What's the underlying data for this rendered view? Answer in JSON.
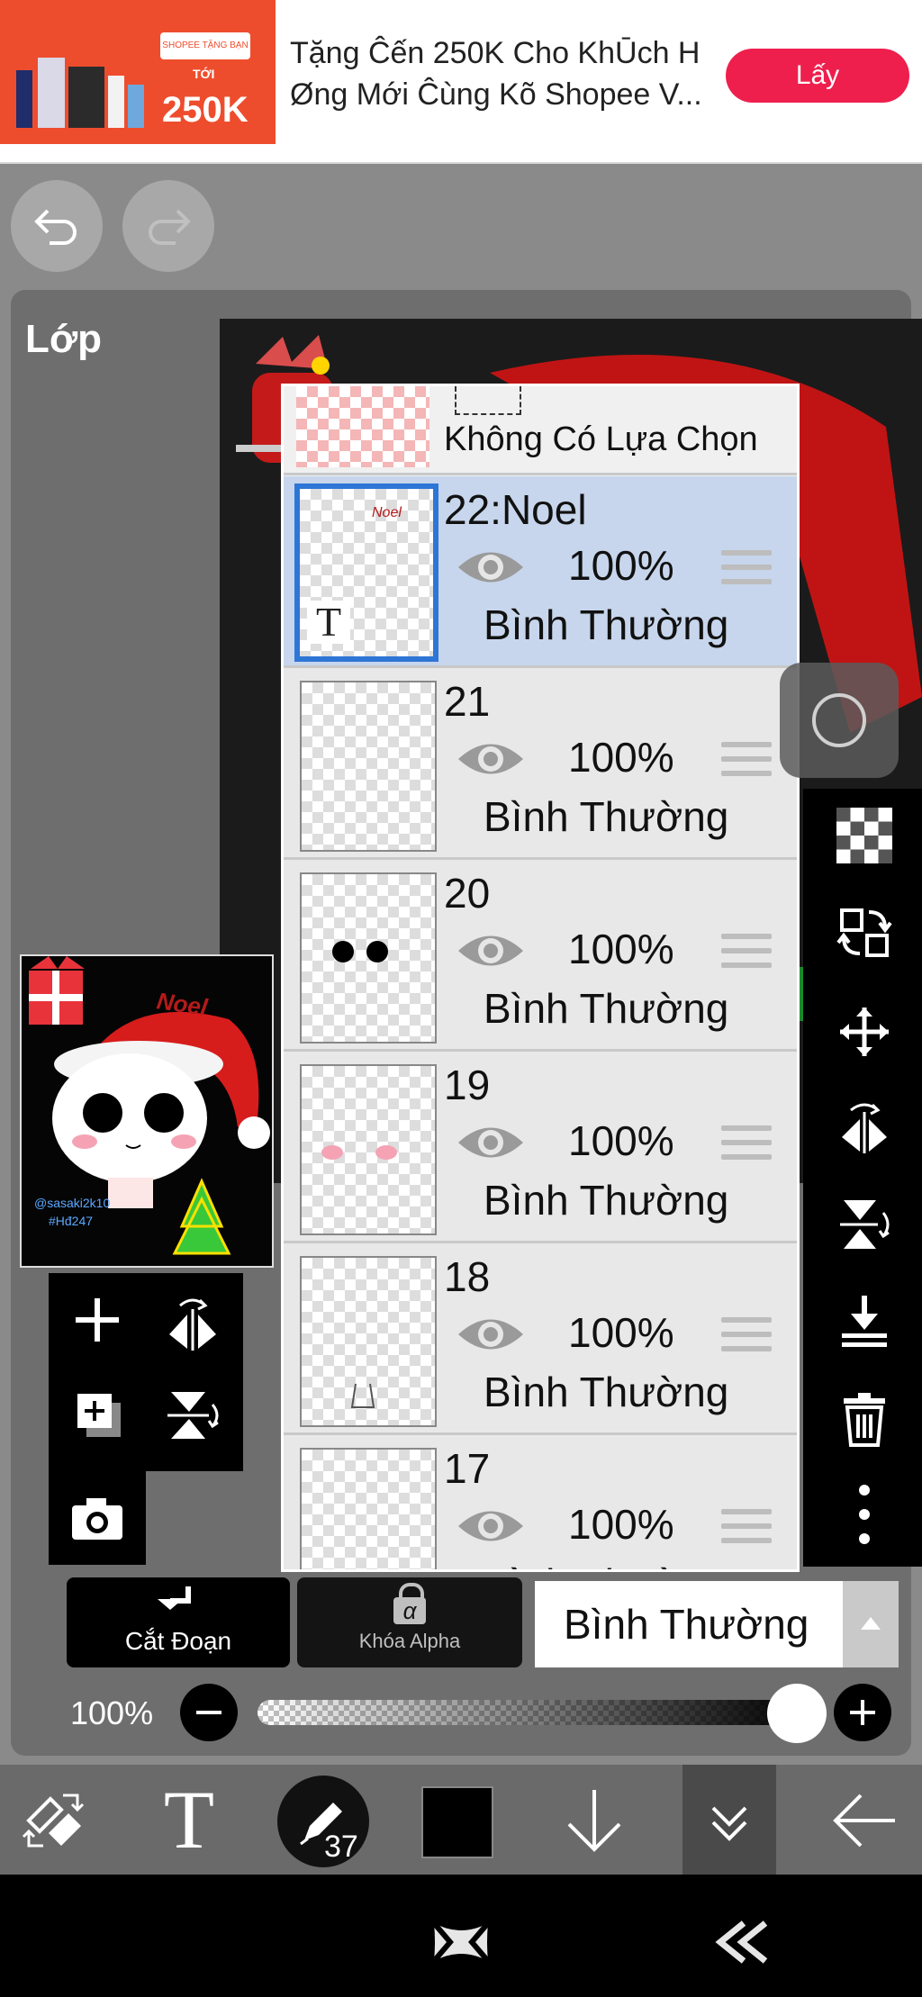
{
  "ad": {
    "image_amount": "250K",
    "image_prefix": "TỚI",
    "image_brand": "SHOPEE TẶNG BẠN MỚI",
    "text": "Tặng Ĉến 250K Cho KhŪch H Øng Mới Ĉùng Kõ Shopee V...",
    "button_label": "Lấy"
  },
  "panel": {
    "title": "Lớp"
  },
  "layers": {
    "top_item_label": "Không Có Lựa Chọn",
    "items": [
      {
        "name": "22:Noel",
        "opacity": "100%",
        "blend": "Bình Thường",
        "thumb_text": "Noel",
        "type_glyph": "T"
      },
      {
        "name": "21",
        "opacity": "100%",
        "blend": "Bình Thường"
      },
      {
        "name": "20",
        "opacity": "100%",
        "blend": "Bình Thường"
      },
      {
        "name": "19",
        "opacity": "100%",
        "blend": "Bình Thường"
      },
      {
        "name": "18",
        "opacity": "100%",
        "blend": "Bình Thường"
      },
      {
        "name": "17",
        "opacity": "100%",
        "blend": "Bình Thường"
      }
    ]
  },
  "preview": {
    "hat_text": "Noel",
    "credit_line1": "@sasaki2k10",
    "credit_line2": "#Hđ247"
  },
  "bottom": {
    "cut_label": "Cắt Đoạn",
    "alpha_label": "Khóa Alpha",
    "alpha_glyph": "α",
    "blend_mode": "Bình Thường",
    "opacity_label": "100%",
    "brush_size": "37"
  },
  "colors": {
    "accent_selected": "#2e76d6",
    "shopee": "#ee4d2d",
    "ad_button": "#ee1f4d"
  }
}
